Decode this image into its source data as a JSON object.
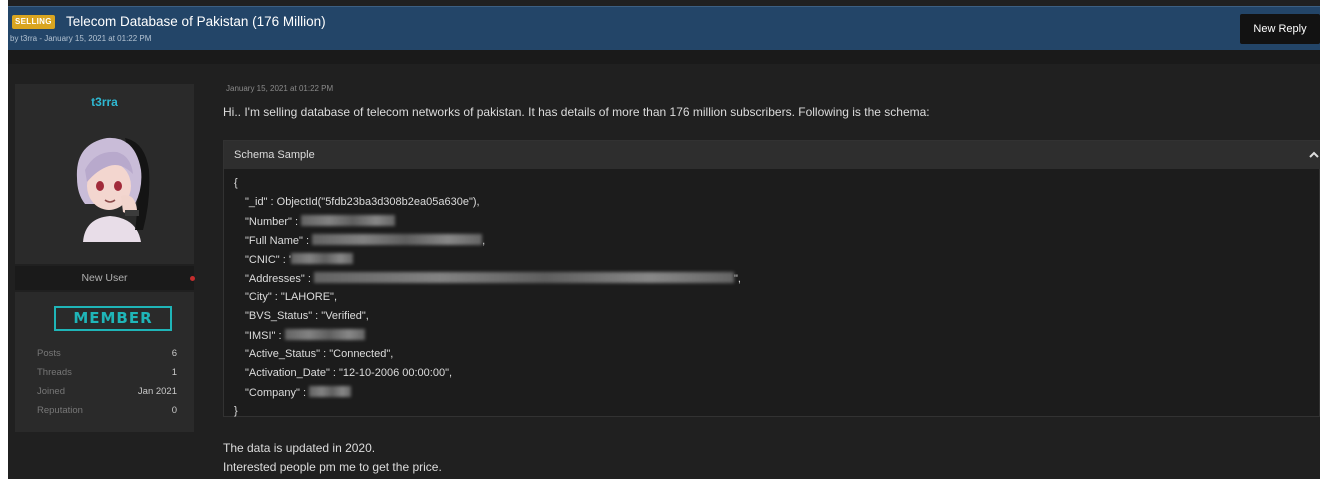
{
  "thread": {
    "prefix": "SELLING",
    "title": "Telecom Database of Pakistan (176 Million)",
    "meta": "by t3rra - January 15, 2021 at 01:22 PM",
    "new_reply_label": "New Reply"
  },
  "user": {
    "username": "t3rra",
    "title": "New User",
    "badge": "MEMBER",
    "stats": [
      {
        "label": "Posts",
        "value": "6"
      },
      {
        "label": "Threads",
        "value": "1"
      },
      {
        "label": "Joined",
        "value": "Jan 2021"
      },
      {
        "label": "Reputation",
        "value": "0"
      }
    ]
  },
  "post": {
    "date": "January 15, 2021 at 01:22 PM",
    "intro": "Hi.. I'm selling database of telecom networks of pakistan. It has details of more than 176 million subscribers. Following is the schema:",
    "schema_title": "Schema Sample",
    "code_lines": [
      {
        "text": "{"
      },
      {
        "text": "\"_id\" : ObjectId(\"5fdb23ba3d308b2ea05a630e\"),"
      },
      {
        "text": "\"Number\" :"
      },
      {
        "text": "\"Full Name\" :",
        "suffix": ","
      },
      {
        "text": "\"CNIC\" : '"
      },
      {
        "text": "\"Addresses\" :",
        "suffix": "\","
      },
      {
        "text": "\"City\" : \"LAHORE\","
      },
      {
        "text": "\"BVS_Status\" : \"Verified\","
      },
      {
        "text": "\"IMSI\" :"
      },
      {
        "text": "\"Active_Status\" : \"Connected\","
      },
      {
        "text": "\"Activation_Date\" : \"12-10-2006 00:00:00\","
      },
      {
        "text": "\"Company\" :"
      },
      {
        "text": "}"
      }
    ],
    "footer_lines": [
      "The data is updated in 2020.",
      "Interested people pm me to get the price."
    ]
  },
  "colors": {
    "header_bar": "#234568",
    "prefix_badge": "#d9a520",
    "username": "#2fb8d2",
    "member_badge": "#1fb5b8",
    "status_dot": "#c42d2d"
  },
  "icons": {
    "collapse": "chevron-up-icon",
    "status": "status-dot-icon"
  }
}
